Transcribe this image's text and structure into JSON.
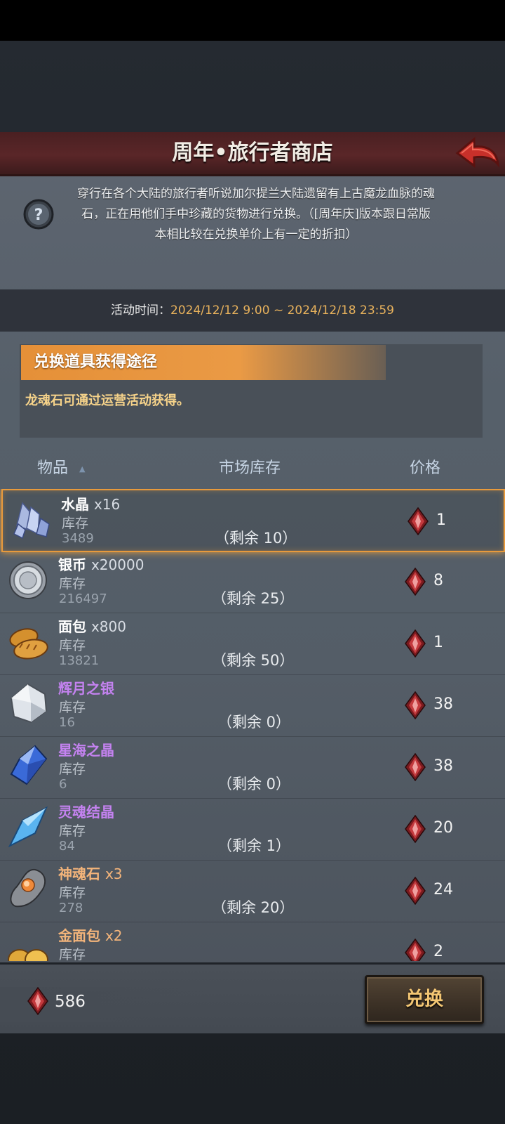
{
  "header": {
    "title": "周年•旅行者商店"
  },
  "intro": {
    "lines": [
      "穿行在各个大陆的旅行者听说加尔提兰大陆遗留有上古魔龙血脉的魂",
      "石，正在用他们手中珍藏的货物进行兑换。（[周年庆]版本跟日常版",
      "本相比较在兑换单价上有一定的折扣）"
    ]
  },
  "event_time": {
    "label": "活动时间：",
    "value": "2024/12/12 9:00 ~ 2024/12/18 23:59"
  },
  "acquire": {
    "header": "兑换道具获得途径",
    "body": "龙魂石可通过运营活动获得。"
  },
  "table": {
    "col_item": "物品",
    "col_stock": "市场库存",
    "col_price": "价格",
    "sort_indicator": "▲"
  },
  "items": [
    {
      "name": "水晶",
      "qty": "x16",
      "stock_label": "库存",
      "stock": "3489",
      "remain": "（剩余 10）",
      "price": "1",
      "rarity": "white",
      "icon": "crystal-icon"
    },
    {
      "name": "银币",
      "qty": "x20000",
      "stock_label": "库存",
      "stock": "216497",
      "remain": "（剩余 25）",
      "price": "8",
      "rarity": "white",
      "icon": "silver-coin-icon"
    },
    {
      "name": "面包",
      "qty": "x800",
      "stock_label": "库存",
      "stock": "13821",
      "remain": "（剩余 50）",
      "price": "1",
      "rarity": "white",
      "icon": "bread-icon"
    },
    {
      "name": "辉月之银",
      "qty": "",
      "stock_label": "库存",
      "stock": "16",
      "remain": "（剩余 0）",
      "price": "38",
      "rarity": "purple",
      "icon": "moon-silver-icon"
    },
    {
      "name": "星海之晶",
      "qty": "",
      "stock_label": "库存",
      "stock": "6",
      "remain": "（剩余 0）",
      "price": "38",
      "rarity": "purple",
      "icon": "star-crystal-icon"
    },
    {
      "name": "灵魂结晶",
      "qty": "",
      "stock_label": "库存",
      "stock": "84",
      "remain": "（剩余 1）",
      "price": "20",
      "rarity": "purple",
      "icon": "soul-crystal-icon"
    },
    {
      "name": "神魂石",
      "qty": "x3",
      "stock_label": "库存",
      "stock": "278",
      "remain": "（剩余 20）",
      "price": "24",
      "rarity": "orange",
      "icon": "divine-stone-icon"
    },
    {
      "name": "金面包",
      "qty": "x2",
      "stock_label": "库存",
      "stock": "",
      "remain": "",
      "price": "2",
      "rarity": "orange",
      "icon": "golden-bread-icon"
    }
  ],
  "footer": {
    "balance": "586",
    "exchange_label": "兑换"
  },
  "colors": {
    "accent_orange": "#e89a3c",
    "purple_rarity": "#c482f0",
    "orange_rarity": "#f3b47a",
    "time_value": "#e8b25c",
    "acquire_body": "#f6d38a"
  }
}
